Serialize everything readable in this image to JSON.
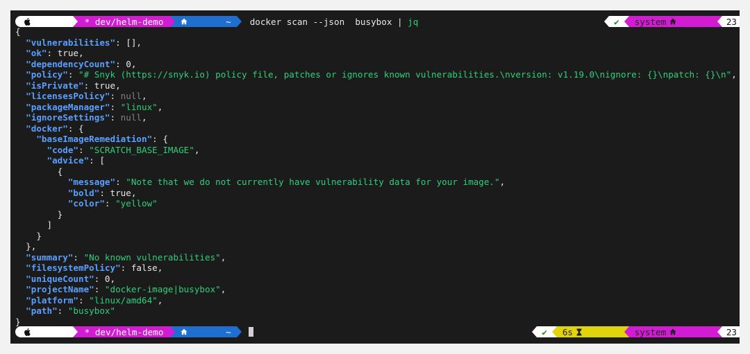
{
  "prompt": {
    "context": "dev/helm-demo",
    "dir": "~",
    "command_docker": "docker scan --json  busybox | ",
    "command_pipe": "jq"
  },
  "right_prompt_top": {
    "check": "✔",
    "env": "system",
    "time": "23"
  },
  "right_prompt_bottom": {
    "check": "✔",
    "duration": "6s",
    "env": "system",
    "time": "23"
  },
  "output": {
    "open_brace": "{",
    "close_brace": "}",
    "vulnerabilities": {
      "key": "\"vulnerabilities\"",
      "value": "[]"
    },
    "ok": {
      "key": "\"ok\"",
      "value": "true"
    },
    "dependencyCount": {
      "key": "\"dependencyCount\"",
      "value": "0"
    },
    "policy": {
      "key": "\"policy\"",
      "value": "\"# Snyk (https://snyk.io) policy file, patches or ignores known vulnerabilities.\\nversion: v1.19.0\\nignore: {}\\npatch: {}\\n\""
    },
    "isPrivate": {
      "key": "\"isPrivate\"",
      "value": "true"
    },
    "licensesPolicy": {
      "key": "\"licensesPolicy\"",
      "value": "null"
    },
    "packageManager": {
      "key": "\"packageManager\"",
      "value": "\"linux\""
    },
    "ignoreSettings": {
      "key": "\"ignoreSettings\"",
      "value": "null"
    },
    "docker": {
      "key": "\"docker\""
    },
    "baseImageRemediation": {
      "key": "\"baseImageRemediation\""
    },
    "code": {
      "key": "\"code\"",
      "value": "\"SCRATCH_BASE_IMAGE\""
    },
    "advice": {
      "key": "\"advice\""
    },
    "message": {
      "key": "\"message\"",
      "value": "\"Note that we do not currently have vulnerability data for your image.\""
    },
    "bold": {
      "key": "\"bold\"",
      "value": "true"
    },
    "color": {
      "key": "\"color\"",
      "value": "\"yellow\""
    },
    "summary": {
      "key": "\"summary\"",
      "value": "\"No known vulnerabilities\""
    },
    "filesystemPolicy": {
      "key": "\"filesystemPolicy\"",
      "value": "false"
    },
    "uniqueCount": {
      "key": "\"uniqueCount\"",
      "value": "0"
    },
    "projectName": {
      "key": "\"projectName\"",
      "value": "\"docker-image|busybox\""
    },
    "platform": {
      "key": "\"platform\"",
      "value": "\"linux/amd64\""
    },
    "path": {
      "key": "\"path\"",
      "value": "\"busybox\""
    }
  },
  "colors": {
    "background": "#1b1b1b",
    "key": "#5aa0ff",
    "string": "#2fd07a",
    "null": "#808080",
    "context_segment": "#d21bd2",
    "dir_segment": "#1f6fd1",
    "duration_segment": "#e2d40c"
  },
  "icons": {
    "os": "apple-icon",
    "context": "asterisk-icon",
    "dir": "home-icon",
    "env": "home-icon",
    "duration": "hourglass-icon"
  }
}
